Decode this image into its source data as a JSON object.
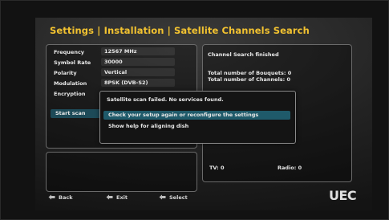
{
  "header": {
    "title": "Settings | Installation | Satellite Channels Search"
  },
  "settings": [
    {
      "label": "Frequency",
      "value": "12567   MHz"
    },
    {
      "label": "Symbol Rate",
      "value": "30000"
    },
    {
      "label": "Polarity",
      "value": "Vertical"
    },
    {
      "label": "Modulation",
      "value": "8PSK (DVB-S2)"
    },
    {
      "label": "Encryption",
      "value": ""
    }
  ],
  "start_scan_label": "Start scan",
  "status": {
    "message": "Channel Search finished",
    "bouquets": "Total number of Bouquets: 0",
    "channels": "Total number of Channels: 0",
    "tv": "TV: 0",
    "radio": "Radio: 0"
  },
  "dialog": {
    "message": "Satellite scan failed. No services found.",
    "options": [
      "Check your setup again or reconfigure the settings",
      "Show help for aligning dish"
    ]
  },
  "footer": [
    {
      "label": "Back",
      "icon": "back-button-icon"
    },
    {
      "label": "Exit",
      "icon": "exit-button-icon"
    },
    {
      "label": "Select",
      "icon": "select-button-icon"
    }
  ],
  "brand": {
    "logo_text": "UEC"
  },
  "colors": {
    "title": "#f2c230",
    "highlight": "#1f5a6a"
  }
}
